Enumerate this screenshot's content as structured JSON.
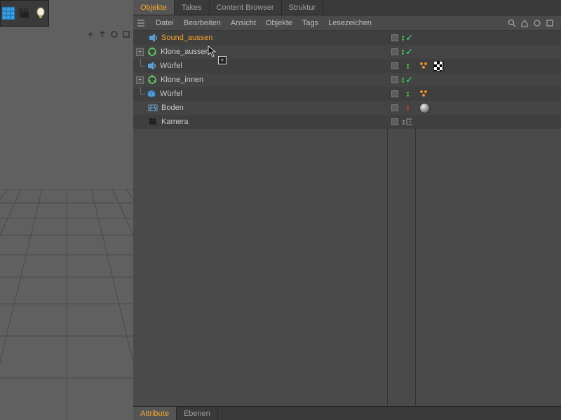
{
  "tabs": {
    "objects": "Objekte",
    "takes": "Takes",
    "content_browser": "Content Browser",
    "struktur": "Struktur"
  },
  "menu": {
    "datei": "Datei",
    "bearbeiten": "Bearbeiten",
    "ansicht": "Ansicht",
    "objekte": "Objekte",
    "tags": "Tags",
    "lesezeichen": "Lesezeichen"
  },
  "hierarchy": [
    {
      "name": "Sound_aussen",
      "icon": "sound-effector",
      "depth": 0,
      "selected": true,
      "expand": null,
      "vis": "gray",
      "dots": "gg",
      "tick": true
    },
    {
      "name": "Klone_aussen",
      "icon": "cloner",
      "depth": 0,
      "expand": "-",
      "vis": "gray",
      "dots": "gg",
      "tick": true
    },
    {
      "name": "Würfel",
      "icon": "sound-effector",
      "depth": 1,
      "expand": null,
      "vis": "gray",
      "dots": "gg",
      "extra": [
        "effector",
        "checker"
      ]
    },
    {
      "name": "Klone_innen",
      "icon": "cloner",
      "depth": 0,
      "expand": "-",
      "vis": "gray",
      "dots": "gg",
      "tick": true
    },
    {
      "name": "Würfel",
      "icon": "cube",
      "depth": 1,
      "expand": null,
      "vis": "gray",
      "dots": "gg",
      "extra": [
        "effector"
      ]
    },
    {
      "name": "Boden",
      "icon": "floor",
      "depth": 0,
      "expand": null,
      "vis": "gray",
      "dots": "rr",
      "extra": [
        "sphere"
      ]
    },
    {
      "name": "Kamera",
      "icon": "camera",
      "depth": 0,
      "expand": null,
      "vis": "gray",
      "dots": "grey",
      "extra": [
        "target"
      ]
    }
  ],
  "bottom_tabs": {
    "attribute": "Attribute",
    "ebenen": "Ebenen"
  },
  "colors": {
    "accent": "#f5a52e",
    "green": "#2ecc71"
  }
}
